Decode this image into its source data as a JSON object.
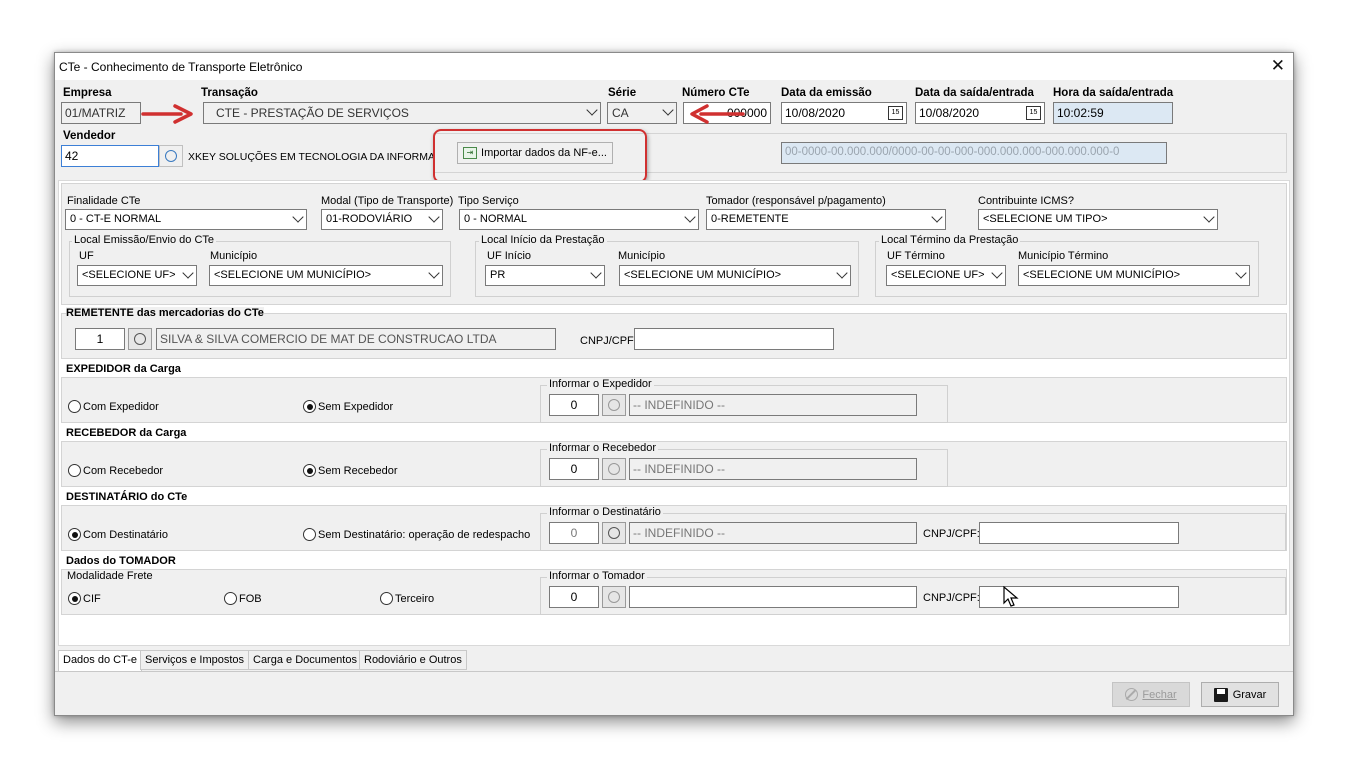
{
  "window": {
    "title": "CTe - Conhecimento de Transporte Eletrônico"
  },
  "header": {
    "empresa_label": "Empresa",
    "empresa_value": "01/MATRIZ",
    "transacao_label": "Transação",
    "transacao_value": "CTE - PRESTAÇÃO DE SERVIÇOS",
    "serie_label": "Série",
    "serie_value": "CA",
    "numero_label": "Número CTe",
    "numero_value": "000000",
    "emissao_label": "Data da emissão",
    "emissao_value": "10/08/2020",
    "saida_label": "Data da saída/entrada",
    "saida_value": "10/08/2020",
    "hora_label": "Hora da saída/entrada",
    "hora_value": "10:02:59",
    "vendedor_label": "Vendedor",
    "vendedor_value": "42",
    "vendedor_name": "XKEY SOLUÇÕES EM TECNOLOGIA DA INFORMAÇÃ",
    "import_button": "Importar dados da NF-e...",
    "chave_placeholder": "00-0000-00.000.000/0000-00-00-000-000.000.000-000.000.000-0",
    "calendar_glyph": "15"
  },
  "params": {
    "finalidade_label": "Finalidade CTe",
    "finalidade_value": "0 - CT-E NORMAL",
    "modal_label": "Modal (Tipo de Transporte)",
    "modal_value": "01-RODOVIÁRIO",
    "tipo_servico_label": "Tipo Serviço",
    "tipo_servico_value": "0 - NORMAL",
    "tomador_label": "Tomador (responsável p/pagamento)",
    "tomador_value": "0-REMETENTE",
    "contribuinte_label": "Contribuinte ICMS?",
    "contribuinte_value": "<SELECIONE UM TIPO>",
    "emissao_group": "Local Emissão/Envio do CTe",
    "uf_label": "UF",
    "uf_value": "<SELECIONE UF>",
    "municipio_label": "Município",
    "municipio_value": "<SELECIONE UM MUNICÍPIO>",
    "inicio_group": "Local Início da Prestação",
    "uf_inicio_label": "UF Início",
    "uf_inicio_value": "PR",
    "municipio_inicio_label": "Município",
    "municipio_inicio_value": "<SELECIONE UM MUNICÍPIO>",
    "termino_group": "Local Término da Prestação",
    "uf_termino_label": "UF Término",
    "uf_termino_value": "<SELECIONE UF>",
    "municipio_termino_label": "Município Término",
    "municipio_termino_value": "<SELECIONE UM MUNICÍPIO>"
  },
  "remetente": {
    "title": "REMETENTE das mercadorias do CTe",
    "code": "1",
    "name": "SILVA & SILVA COMERCIO DE MAT DE CONSTRUCAO LTDA",
    "cnpj_label": "CNPJ/CPF:"
  },
  "expedidor": {
    "title": "EXPEDIDOR da Carga",
    "opt_with": "Com Expedidor",
    "opt_without": "Sem Expedidor",
    "informar_label": "Informar o Expedidor",
    "code": "0",
    "name": "-- INDEFINIDO --"
  },
  "recebedor": {
    "title": "RECEBEDOR da Carga",
    "opt_with": "Com Recebedor",
    "opt_without": "Sem Recebedor",
    "informar_label": "Informar o Recebedor",
    "code": "0",
    "name": "-- INDEFINIDO --"
  },
  "destinatario": {
    "title": "DESTINATÁRIO do CTe",
    "opt_with": "Com Destinatário",
    "opt_without": "Sem Destinatário: operação de redespacho",
    "informar_label": "Informar o Destinatário",
    "code": "0",
    "name": "-- INDEFINIDO --",
    "cnpj_label": "CNPJ/CPF:"
  },
  "tomador": {
    "title": "Dados do TOMADOR",
    "modalidade_label": "Modalidade Frete",
    "opt_cif": "CIF",
    "opt_fob": "FOB",
    "opt_terceiro": "Terceiro",
    "informar_label": "Informar o Tomador",
    "code": "0",
    "cnpj_label": "CNPJ/CPF:"
  },
  "tabs": [
    {
      "label": "Dados do CT-e"
    },
    {
      "label": "Serviços e Impostos"
    },
    {
      "label": "Carga e Documentos"
    },
    {
      "label": "Rodoviário e Outros"
    }
  ],
  "footer": {
    "fechar": "Fechar",
    "gravar": "Gravar"
  },
  "colors": {
    "annotation_red": "#d03030",
    "readonly_blue": "#dce8f3"
  }
}
